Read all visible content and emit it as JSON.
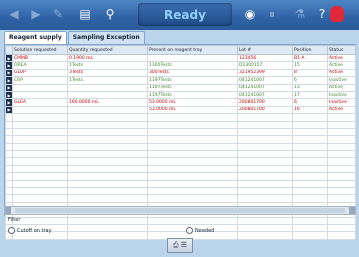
{
  "toolbar": {
    "status": "Ready",
    "icons": [
      "back-icon",
      "forward-icon",
      "tools-icon",
      "report-icon",
      "search-icon",
      "record-icon",
      "pause-icon",
      "sample-icon",
      "help-icon",
      "hand-icon"
    ]
  },
  "tabs": [
    "Reagent supply",
    "Sampling Exception"
  ],
  "table": {
    "headers": [
      "",
      "Solution requested",
      "Quantity requested",
      "Present on reagent tray",
      "Lot #",
      "Position",
      "Status"
    ],
    "rows": [
      {
        "sel": "▶",
        "name": "CMMB",
        "qty": "0.1900 mL",
        "present": "",
        "lot": "123456",
        "pos": "B1 A",
        "status": "Active",
        "color": "red"
      },
      {
        "sel": "▶",
        "name": "OREA",
        "qty": "1Tests",
        "present": "1160Tests",
        "lot": "D1300157",
        "pos": "15",
        "status": "Active",
        "color": "green"
      },
      {
        "sel": "▶",
        "name": "GLUP",
        "qty": "3Tests",
        "present": "300Tests",
        "lot": "321952399",
        "pos": "8",
        "status": "Active",
        "color": "red"
      },
      {
        "sel": "▶",
        "name": "CRP",
        "qty": "1Tests",
        "present": "1197Tests",
        "lot": "041241007",
        "pos": "6",
        "status": "Inactive",
        "color": "green"
      },
      {
        "sel": "▶",
        "name": "",
        "qty": "",
        "present": "1197Tests",
        "lot": "041241007",
        "pos": "13",
        "status": "Active",
        "color": "green"
      },
      {
        "sel": "▶",
        "name": "",
        "qty": "",
        "present": "1197Tests",
        "lot": "041241007",
        "pos": "17",
        "status": "Inactive",
        "color": "green"
      },
      {
        "sel": "▶",
        "name": "GLEA",
        "qty": "160.0000 mL",
        "present": "53.0000 mL",
        "lot": "200801700",
        "pos": "6",
        "status": "Inactive",
        "color": "red"
      },
      {
        "sel": "▶",
        "name": "",
        "qty": "",
        "present": "53.0000 mL",
        "lot": "200801700",
        "pos": "16",
        "status": "Active",
        "color": "red"
      }
    ],
    "empty_rows": 17
  },
  "filter": {
    "label": "Filter",
    "option1": "Cutoff on tray",
    "option2": "Needed"
  },
  "bottom_button_label": "⎙ ☰"
}
